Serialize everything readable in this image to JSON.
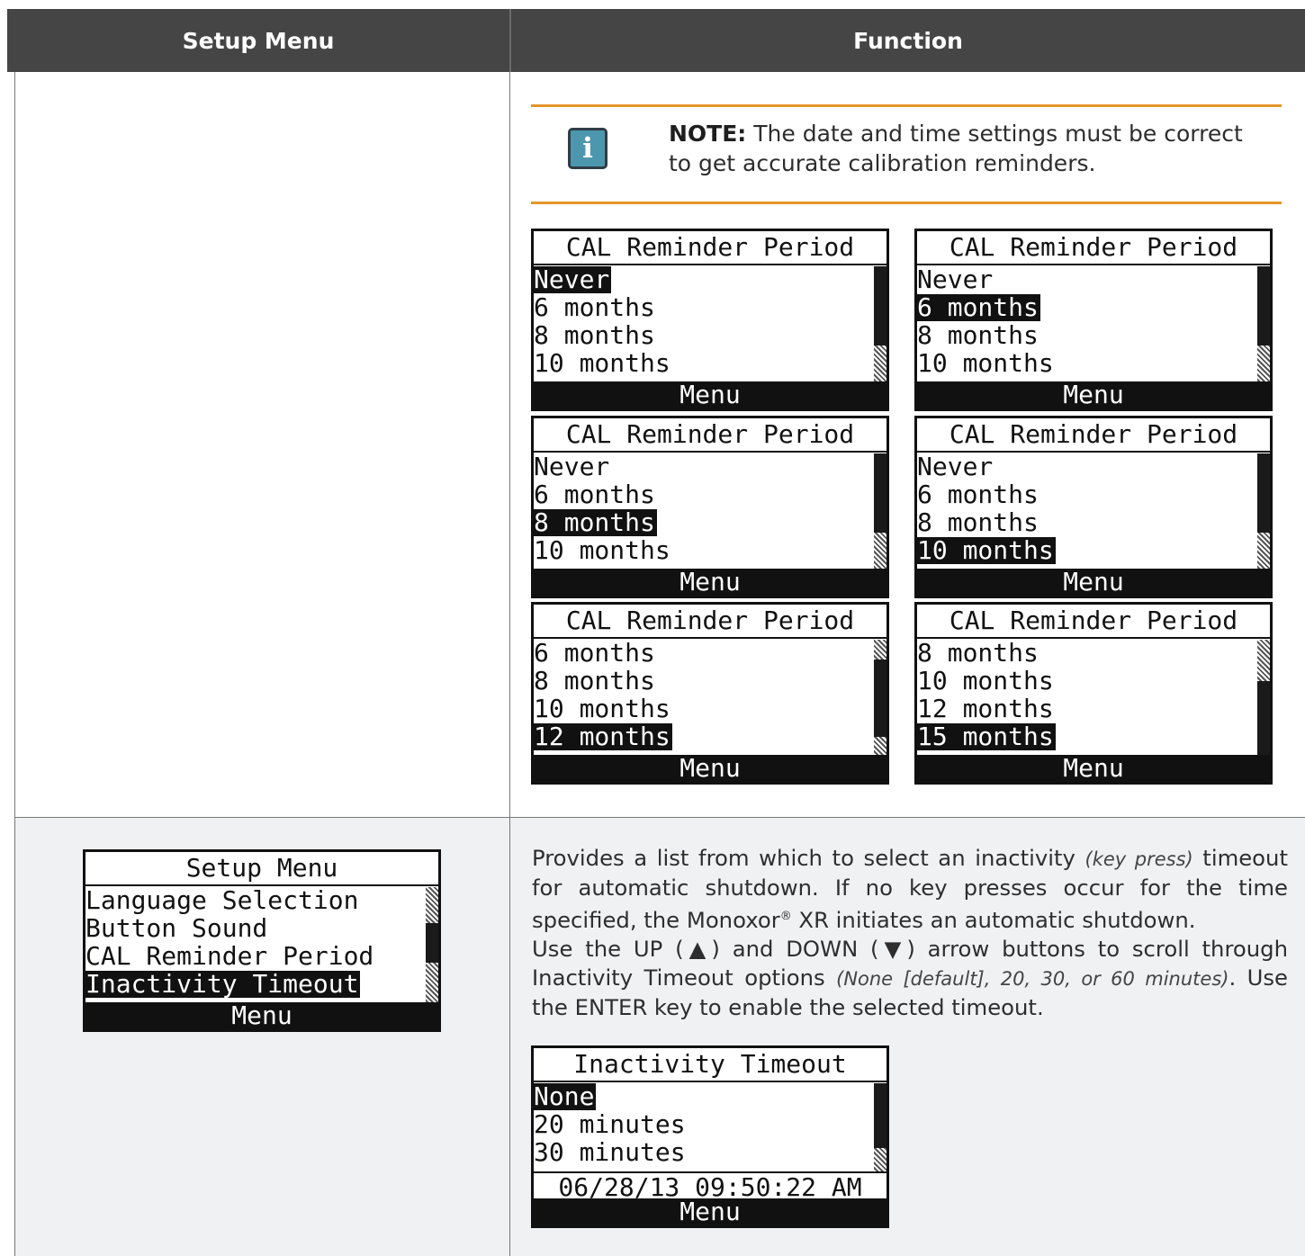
{
  "table": {
    "headers": [
      "Setup Menu",
      "Function"
    ]
  },
  "note": {
    "label": "NOTE:",
    "text": " The date and time settings must be correct to get accurate calibration reminders.",
    "icon": "info-icon",
    "icon_glyph": "i",
    "accent_color": "#e5952a",
    "icon_color": "#4c97ae"
  },
  "cal_screens": [
    {
      "title": "CAL Reminder Period",
      "lines": [
        "Never",
        "6 months",
        "8 months",
        "10 months"
      ],
      "selected": 0,
      "footer": "Menu"
    },
    {
      "title": "CAL Reminder Period",
      "lines": [
        "Never",
        "6 months",
        "8 months",
        "10 months"
      ],
      "selected": 1,
      "footer": "Menu"
    },
    {
      "title": "CAL Reminder Period",
      "lines": [
        "Never",
        "6 months",
        "8 months",
        "10 months"
      ],
      "selected": 2,
      "footer": "Menu"
    },
    {
      "title": "CAL Reminder Period",
      "lines": [
        "Never",
        "6 months",
        "8 months",
        "10 months"
      ],
      "selected": 3,
      "footer": "Menu"
    },
    {
      "title": "CAL Reminder Period",
      "lines": [
        "6 months",
        "8 months",
        "10 months",
        "12 months"
      ],
      "selected": 3,
      "footer": "Menu"
    },
    {
      "title": "CAL Reminder Period",
      "lines": [
        "8 months",
        "10 months",
        "12 months",
        "15 months"
      ],
      "selected": 3,
      "footer": "Menu"
    }
  ],
  "setup_screen": {
    "title": "Setup Menu",
    "lines": [
      "Language Selection",
      "Button Sound",
      "CAL Reminder Period",
      "Inactivity Timeout"
    ],
    "selected": 3,
    "footer": "Menu"
  },
  "description": {
    "p1_a": "Provides a list from which to select an inactivity ",
    "p1_i": "(key press)",
    "p1_b": " timeout for automatic shutdown. If no key presses occur for the time specified, the Monoxor",
    "p1_sup": "®",
    "p1_c": " XR initiates an automatic shutdown.",
    "p2_a": "Use the UP (▲) and DOWN (▼) arrow buttons to scroll through Inactivity Timeout options ",
    "p2_i": "(None [default], 20, 30, or 60 minutes)",
    "p2_b": ". Use the ENTER key to enable the selected timeout."
  },
  "timeout_screen": {
    "title": "Inactivity Timeout",
    "lines": [
      "None",
      "20 minutes",
      "30 minutes"
    ],
    "selected": 0,
    "datetime": "06/28/13 09:50:22 AM",
    "footer": "Menu"
  }
}
